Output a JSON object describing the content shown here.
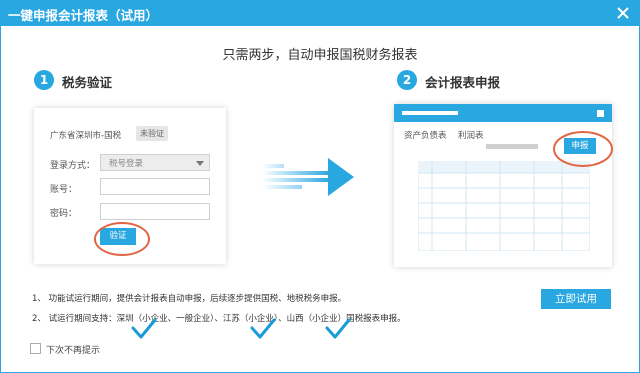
{
  "window": {
    "title": "一键申报会计报表（试用）"
  },
  "headline": "只需两步，自动申报国税财务报表",
  "steps": [
    {
      "num": "1",
      "label": "税务验证"
    },
    {
      "num": "2",
      "label": "会计报表申报"
    }
  ],
  "verify_card": {
    "location": "广东省深圳市-国税",
    "status_badge": "未验证",
    "login_method_label": "登录方式：",
    "login_method_value": "税号登录",
    "account_label": "账号：",
    "password_label": "密码：",
    "verify_button": "验证"
  },
  "report_mock": {
    "tabs": [
      "资产负债表",
      "利润表"
    ],
    "declare_button": "申报"
  },
  "notes": [
    "1、 功能试运行期间，提供会计报表自动申报，后续逐步提供国税、地税税务申报。",
    "2、 试运行期间支持：深圳（小企业、一般企业）、江苏（小企业）、山西（小企业）国税报表申报。"
  ],
  "try_button": "立即试用",
  "no_remind_label": "下次不再提示",
  "colors": {
    "accent": "#29a7e1",
    "ring": "#e26544",
    "check": "#1a9bd7"
  }
}
